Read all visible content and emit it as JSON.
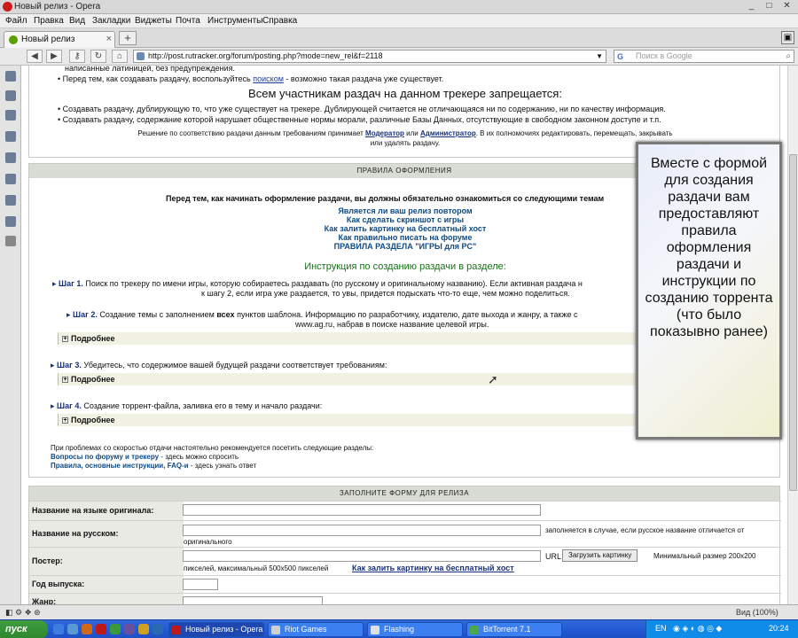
{
  "window": {
    "title": "Новый релиз - Opera",
    "controls": [
      "_",
      "□",
      "✕"
    ]
  },
  "menu": [
    "Файл",
    "Правка",
    "Вид",
    "Закладки",
    "Виджеты",
    "Почта",
    "Инструменты",
    "Справка"
  ],
  "tab": {
    "label": "Новый релиз",
    "close": "×",
    "new": "+"
  },
  "address": {
    "url": "http://post.rutracker.org/forum/posting.php?mode=new_rel&f=2118",
    "search_placeholder": "Поиск в Google",
    "search_engine": "G"
  },
  "top_rules": {
    "line0": "написанные латиницей, без предупреждения.",
    "line1_pre": "Перед тем, как создавать раздачу, воспользуйтесь ",
    "line1_link": "поиском",
    "line1_post": " - возможно такая раздача уже существует.",
    "heading": "Всем участникам раздач на данном трекере запрещается:",
    "bullet1": "Создавать раздачу, дублирующую то, что уже существует на трекере. Дублирующей считается не отличающаяся ни по содержанию, ни по качеству информация.",
    "bullet2": "Создавать раздачу, содержание которой нарушает общественные нормы морали, различные Базы Данных, отсутствующие в свободном законном доступе и т.п.",
    "decision_pre": "Решение по соответствию раздачи данным требованиям принимает ",
    "moderator": "Модератор",
    "or": " или ",
    "admin": "Администратор",
    "decision_post": ". В их полномочиях редактировать, перемещать, закрывать",
    "decision_line2": "или удалять раздачу."
  },
  "rules_panel": {
    "header": "ПРАВИЛА ОФОРМЛЕНИЯ",
    "intro": "Перед тем, как начинать оформление раздачи, вы должны обязательно ознакомиться со следующими темам",
    "links": [
      "Является ли ваш релиз повтором",
      "Как сделать скриншот с игры",
      "Как залить картинку на бесплатный хост",
      "Как правильно писать на форуме",
      "ПРАВИЛА РАЗДЕЛА \"ИГРЫ для PC\""
    ],
    "instruction_title": "Инструкция по созданию раздачи в разделе:",
    "step1_label": "Шаг 1.",
    "step1_text": " Поиск по трекеру по имени игры, которую собираетесь раздавать (по русскому и оригинальному названию). Если активная раздача н",
    "step1_line2": "к шагу 2, если игра уже раздается, то увы, придется подыскать что-то еще, чем можно поделиться.",
    "step2_label": "Шаг 2.",
    "step2_text_a": " Создание темы с заполнением ",
    "step2_bold": "всех",
    "step2_text_b": " пунктов шаблона. Информацию по разработчику, издателю, дате выхода и жанру, а также с",
    "step2_line2": "www.ag.ru, набрав в поиске название целевой игры.",
    "more": "Подробнее",
    "step3_label": "Шаг 3.",
    "step3_text": " Убедитесь, что содержимое вашей будущей раздачи соответствует требованиям:",
    "step4_label": "Шаг 4.",
    "step4_text": " Создание торрент-файла, заливка его в тему и начало раздачи:",
    "speed_note": "При проблемах со скоростью отдачи настоятельно рекомендуется посетить следующие разделы:",
    "faq_link": "Вопросы по форуму и трекеру",
    "faq_text": " - здесь можно спросить",
    "rules_link": "Правила, основные инструкции, FAQ-и",
    "rules_text": " - здесь узнать ответ"
  },
  "form_panel": {
    "header": "ЗАПОЛНИТЕ ФОРМУ ДЛЯ РЕЛИЗА",
    "name_orig": "Название на языке оригинала:",
    "name_ru": "Название на русском:",
    "name_ru_hint1": "заполняется в случае, если русское название отличается от",
    "name_ru_hint2": "оригинального",
    "poster": "Постер:",
    "url_label": "URL",
    "upload_button": "Загрузить картинку",
    "poster_hint_right": "Минимальный размер 200x200",
    "poster_hint": "пикселей, максимальный 500x500 пикселей",
    "poster_link": "Как залить картинку на бесплатный хост",
    "year": "Год выпуска:",
    "genre": "Жанр:"
  },
  "overlay": {
    "text": "Вместе с формой для создания раздачи вам предоставляют правила оформления раздачи и инструкции по созданию торрента (что было показывно ранее)"
  },
  "statusbar": {
    "zoom": "Вид (100%)"
  },
  "taskbar": {
    "start": "пуск",
    "tasks": [
      "Новый релиз - Opera",
      "Riot Games",
      "Flashing",
      "BitTorrent 7.1"
    ],
    "lang": "EN",
    "clock": "20:24"
  },
  "colors": {
    "link": "#16317d",
    "green_heading": "#1a6e1a",
    "panel_header": "#d9dcd4",
    "taskbar": "#245cd8"
  }
}
